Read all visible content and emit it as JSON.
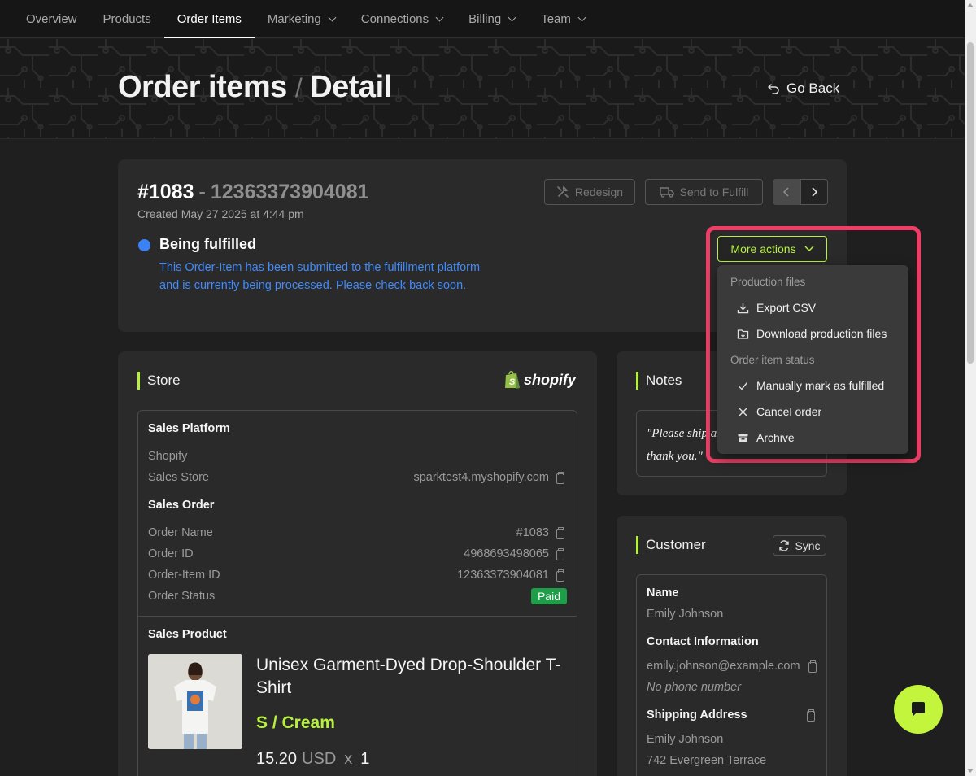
{
  "nav": {
    "items": [
      {
        "label": "Overview"
      },
      {
        "label": "Products"
      },
      {
        "label": "Order Items"
      },
      {
        "label": "Marketing"
      },
      {
        "label": "Connections"
      },
      {
        "label": "Billing"
      },
      {
        "label": "Team"
      }
    ],
    "active": "Order Items"
  },
  "header": {
    "title_main": "Order items",
    "title_sep": "/",
    "title_sub": "Detail",
    "go_back": "Go Back"
  },
  "order": {
    "number": "#1083",
    "dash": "-",
    "id": "12363373904081",
    "created": "Created May 27 2025 at 4:44 pm",
    "status_title": "Being fulfilled",
    "status_desc": "This Order-Item has been submitted to the fulfillment platform and is currently being processed. Please check back soon.",
    "status_color": "#3b82f6",
    "redesign_label": "Redesign",
    "send_fulfill_label": "Send to Fulfill",
    "more_actions_label": "More actions"
  },
  "menu": {
    "group1": "Production files",
    "export_csv": "Export CSV",
    "download_files": "Download production files",
    "group2": "Order item status",
    "mark_fulfilled": "Manually mark as fulfilled",
    "cancel_order": "Cancel order",
    "archive": "Archive"
  },
  "store": {
    "title": "Store",
    "logo_text": "shopify",
    "platform_head": "Sales Platform",
    "platform_name": "Shopify",
    "store_label": "Sales Store",
    "store_value": "sparktest4.myshopify.com",
    "order_head": "Sales Order",
    "order_name_label": "Order Name",
    "order_name_value": "#1083",
    "order_id_label": "Order ID",
    "order_id_value": "4968693498065",
    "item_id_label": "Order-Item ID",
    "item_id_value": "12363373904081",
    "status_label": "Order Status",
    "status_value": "Paid",
    "product_head": "Sales Product",
    "product_name": "Unisex Garment-Dyed Drop-Shoulder T-Shirt",
    "variant": "S / Cream",
    "price": "15.20",
    "currency": "USD",
    "times": "x",
    "quantity": "1"
  },
  "notes": {
    "title": "Notes",
    "text": "\"Please ship as soon as possible, thank you.\""
  },
  "customer": {
    "title": "Customer",
    "sync_label": "Sync",
    "name_head": "Name",
    "name": "Emily Johnson",
    "contact_head": "Contact Information",
    "email": "emily.johnson@example.com",
    "phone": "No phone number",
    "address_head": "Shipping Address",
    "addr_name": "Emily Johnson",
    "addr_line1": "742 Evergreen Terrace"
  },
  "colors": {
    "accent": "#b6f23c",
    "highlight": "#ee3e66",
    "paid": "#1e9e48",
    "status_link": "#3d8bff"
  }
}
